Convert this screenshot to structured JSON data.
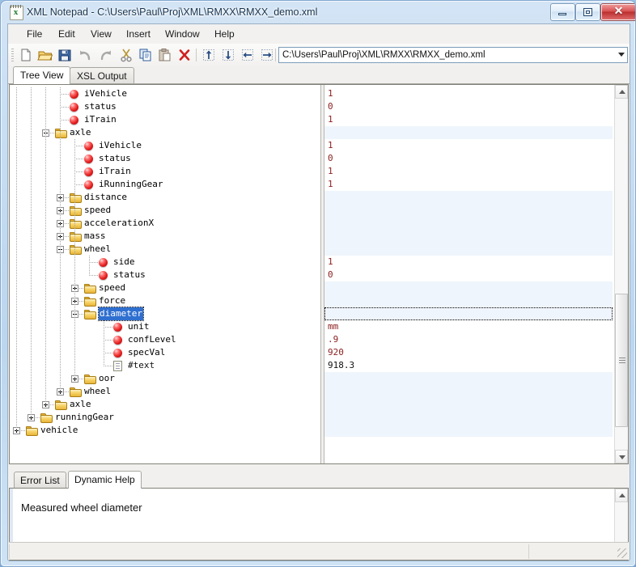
{
  "window": {
    "title": "XML Notepad - C:\\Users\\Paul\\Proj\\XML\\RMXX\\RMXX_demo.xml",
    "app_icon": "xml-notepad-icon",
    "minimize_label": "",
    "maximize_label": "",
    "close_label": "✕"
  },
  "menubar": {
    "items": [
      {
        "label": "File"
      },
      {
        "label": "Edit"
      },
      {
        "label": "View"
      },
      {
        "label": "Insert"
      },
      {
        "label": "Window"
      },
      {
        "label": "Help"
      }
    ]
  },
  "toolbar": {
    "buttons": [
      {
        "name": "new-file-icon"
      },
      {
        "name": "open-file-icon"
      },
      {
        "name": "save-file-icon"
      },
      {
        "name": "undo-icon"
      },
      {
        "name": "redo-icon"
      },
      {
        "name": "cut-icon"
      },
      {
        "name": "copy-icon"
      },
      {
        "name": "paste-icon"
      },
      {
        "name": "delete-icon"
      },
      {
        "name": "move-up-icon"
      },
      {
        "name": "move-down-icon"
      },
      {
        "name": "promote-left-icon"
      },
      {
        "name": "demote-right-icon"
      }
    ],
    "address_value": "C:\\Users\\Paul\\Proj\\XML\\RMXX\\RMXX_demo.xml",
    "address_dropdown_icon": "chevron-down-icon"
  },
  "main_tabs": [
    {
      "label": "Tree View",
      "active": true
    },
    {
      "label": "XSL Output",
      "active": false
    }
  ],
  "tree": {
    "nodes": [
      {
        "label": "iVehicle",
        "kind": "attribute",
        "depth": 4,
        "expander": "none",
        "value": "1",
        "selected": false
      },
      {
        "label": "status",
        "kind": "attribute",
        "depth": 4,
        "expander": "none",
        "value": "0",
        "selected": false
      },
      {
        "label": "iTrain",
        "kind": "attribute",
        "depth": 4,
        "expander": "none",
        "value": "1",
        "selected": false
      },
      {
        "label": "axle",
        "kind": "element",
        "depth": 3,
        "expander": "minus",
        "value": "",
        "selected": false
      },
      {
        "label": "iVehicle",
        "kind": "attribute",
        "depth": 5,
        "expander": "none",
        "value": "1",
        "selected": false
      },
      {
        "label": "status",
        "kind": "attribute",
        "depth": 5,
        "expander": "none",
        "value": "0",
        "selected": false
      },
      {
        "label": "iTrain",
        "kind": "attribute",
        "depth": 5,
        "expander": "none",
        "value": "1",
        "selected": false
      },
      {
        "label": "iRunningGear",
        "kind": "attribute",
        "depth": 5,
        "expander": "none",
        "value": "1",
        "selected": false
      },
      {
        "label": "distance",
        "kind": "element",
        "depth": 4,
        "expander": "plus",
        "value": "",
        "selected": false
      },
      {
        "label": "speed",
        "kind": "element",
        "depth": 4,
        "expander": "plus",
        "value": "",
        "selected": false
      },
      {
        "label": "accelerationX",
        "kind": "element",
        "depth": 4,
        "expander": "plus",
        "value": "",
        "selected": false
      },
      {
        "label": "mass",
        "kind": "element",
        "depth": 4,
        "expander": "plus",
        "value": "",
        "selected": false
      },
      {
        "label": "wheel",
        "kind": "element",
        "depth": 4,
        "expander": "minus",
        "value": "",
        "selected": false
      },
      {
        "label": "side",
        "kind": "attribute",
        "depth": 6,
        "expander": "none",
        "value": "1",
        "selected": false
      },
      {
        "label": "status",
        "kind": "attribute",
        "depth": 6,
        "expander": "none",
        "value": "0",
        "selected": false
      },
      {
        "label": "speed",
        "kind": "element",
        "depth": 5,
        "expander": "plus",
        "value": "",
        "selected": false
      },
      {
        "label": "force",
        "kind": "element",
        "depth": 5,
        "expander": "plus",
        "value": "",
        "selected": false
      },
      {
        "label": "diameter",
        "kind": "element",
        "depth": 5,
        "expander": "minus",
        "value": "",
        "selected": true
      },
      {
        "label": "unit",
        "kind": "attribute",
        "depth": 7,
        "expander": "none",
        "value": "mm",
        "selected": false
      },
      {
        "label": "confLevel",
        "kind": "attribute",
        "depth": 7,
        "expander": "none",
        "value": ".9",
        "selected": false
      },
      {
        "label": "specVal",
        "kind": "attribute",
        "depth": 7,
        "expander": "none",
        "value": "920",
        "selected": false
      },
      {
        "label": "#text",
        "kind": "text",
        "depth": 7,
        "expander": "none",
        "value": "918.3",
        "selected": false
      },
      {
        "label": "oor",
        "kind": "element",
        "depth": 5,
        "expander": "plus",
        "value": "",
        "selected": false
      },
      {
        "label": "wheel",
        "kind": "element",
        "depth": 4,
        "expander": "plus",
        "value": "",
        "selected": false
      },
      {
        "label": "axle",
        "kind": "element",
        "depth": 3,
        "expander": "plus",
        "value": "",
        "selected": false
      },
      {
        "label": "runningGear",
        "kind": "element",
        "depth": 2,
        "expander": "plus",
        "value": "",
        "selected": false
      },
      {
        "label": "vehicle",
        "kind": "element",
        "depth": 1,
        "expander": "plus",
        "value": "",
        "selected": false
      }
    ]
  },
  "bottom_tabs": [
    {
      "label": "Error List",
      "active": false
    },
    {
      "label": "Dynamic Help",
      "active": true
    }
  ],
  "help": {
    "text": "Measured wheel diameter"
  },
  "statusbar": {
    "message": "",
    "segment": "",
    "grip_icon": "resize-grip-icon"
  },
  "colors": {
    "attribute_text": "#8b2020",
    "element_text": "#2349a0",
    "selection": "#2f6fd0",
    "element_row_bg": "#eff5fc"
  }
}
